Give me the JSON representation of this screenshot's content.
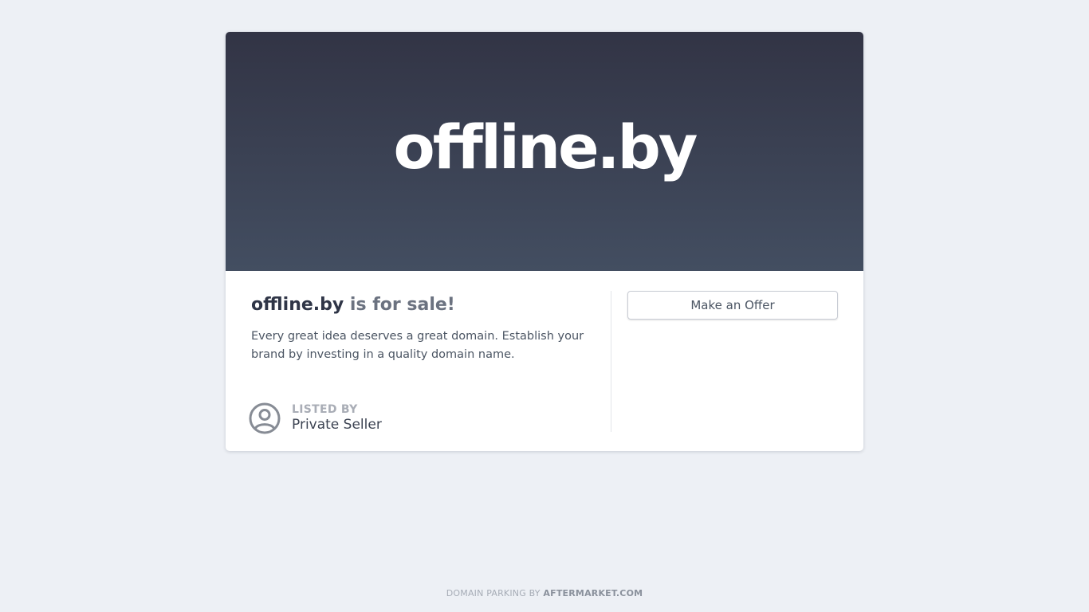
{
  "hero": {
    "domain": "offline.by"
  },
  "listing": {
    "domain": "offline.by",
    "sale_text": " is for sale!",
    "description": "Every great idea deserves a great domain. Establish your brand by investing in a quality domain name.",
    "listed_by_label": "LISTED BY",
    "seller_name": "Private Seller",
    "seller_icon": "user-avatar-icon"
  },
  "actions": {
    "offer_label": "Make an Offer"
  },
  "footer": {
    "prefix": "DOMAIN PARKING BY ",
    "brand": "AFTERMARKET.COM"
  },
  "colors": {
    "page_background": "#edf0f5",
    "hero_gradient_top": "#323445",
    "hero_gradient_bottom": "#434e61",
    "card_background": "#ffffff",
    "headline_strong": "#2f3547"
  }
}
